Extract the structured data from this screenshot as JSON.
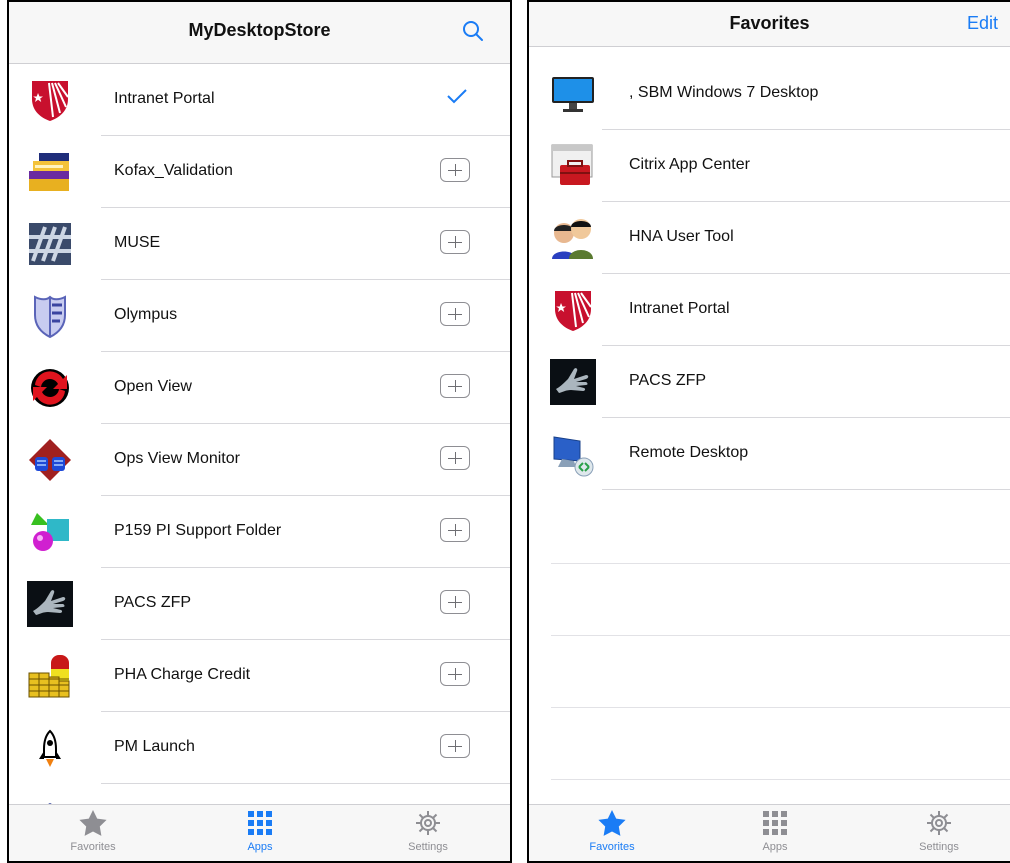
{
  "left": {
    "title": "MyDesktopStore",
    "search_icon": "search-icon",
    "apps": [
      {
        "name": "Intranet Portal",
        "icon": "stanford-shield-icon",
        "added": true
      },
      {
        "name": "Kofax_Validation",
        "icon": "folder-stack-icon",
        "added": false
      },
      {
        "name": "MUSE",
        "icon": "muse-logo-icon",
        "added": false
      },
      {
        "name": "Olympus",
        "icon": "shield-icon",
        "added": false
      },
      {
        "name": "Open View",
        "icon": "refresh-ring-icon",
        "added": false
      },
      {
        "name": "Ops View Monitor",
        "icon": "monitor-face-icon",
        "added": false
      },
      {
        "name": "P159 PI Support Folder",
        "icon": "shapes-folder-icon",
        "added": false
      },
      {
        "name": "PACS ZFP",
        "icon": "xray-hand-icon",
        "added": false
      },
      {
        "name": "PHA Charge Credit",
        "icon": "coins-lock-icon",
        "added": false
      },
      {
        "name": "PM Launch",
        "icon": "rocket-icon",
        "added": false
      }
    ],
    "tabs": [
      {
        "label": "Favorites",
        "icon": "star-icon",
        "active": false
      },
      {
        "label": "Apps",
        "icon": "grid-icon",
        "active": true
      },
      {
        "label": "Settings",
        "icon": "gear-icon",
        "active": false
      }
    ]
  },
  "right": {
    "title": "Favorites",
    "edit_label": "Edit",
    "favorites": [
      {
        "name": ", SBM Windows 7 Desktop",
        "icon": "desktop-monitor-icon"
      },
      {
        "name": "Citrix App Center",
        "icon": "toolbox-window-icon"
      },
      {
        "name": "HNA User Tool",
        "icon": "users-icon"
      },
      {
        "name": "Intranet Portal",
        "icon": "stanford-shield-icon"
      },
      {
        "name": "PACS ZFP",
        "icon": "xray-hand-icon"
      },
      {
        "name": "Remote Desktop",
        "icon": "remote-desktop-icon"
      }
    ],
    "tabs": [
      {
        "label": "Favorites",
        "icon": "star-icon",
        "active": true
      },
      {
        "label": "Apps",
        "icon": "grid-icon",
        "active": false
      },
      {
        "label": "Settings",
        "icon": "gear-icon",
        "active": false
      }
    ]
  },
  "colors": {
    "accent": "#1a7cf5",
    "inactive": "#8e8e93",
    "cardinal": "#c8102e"
  }
}
